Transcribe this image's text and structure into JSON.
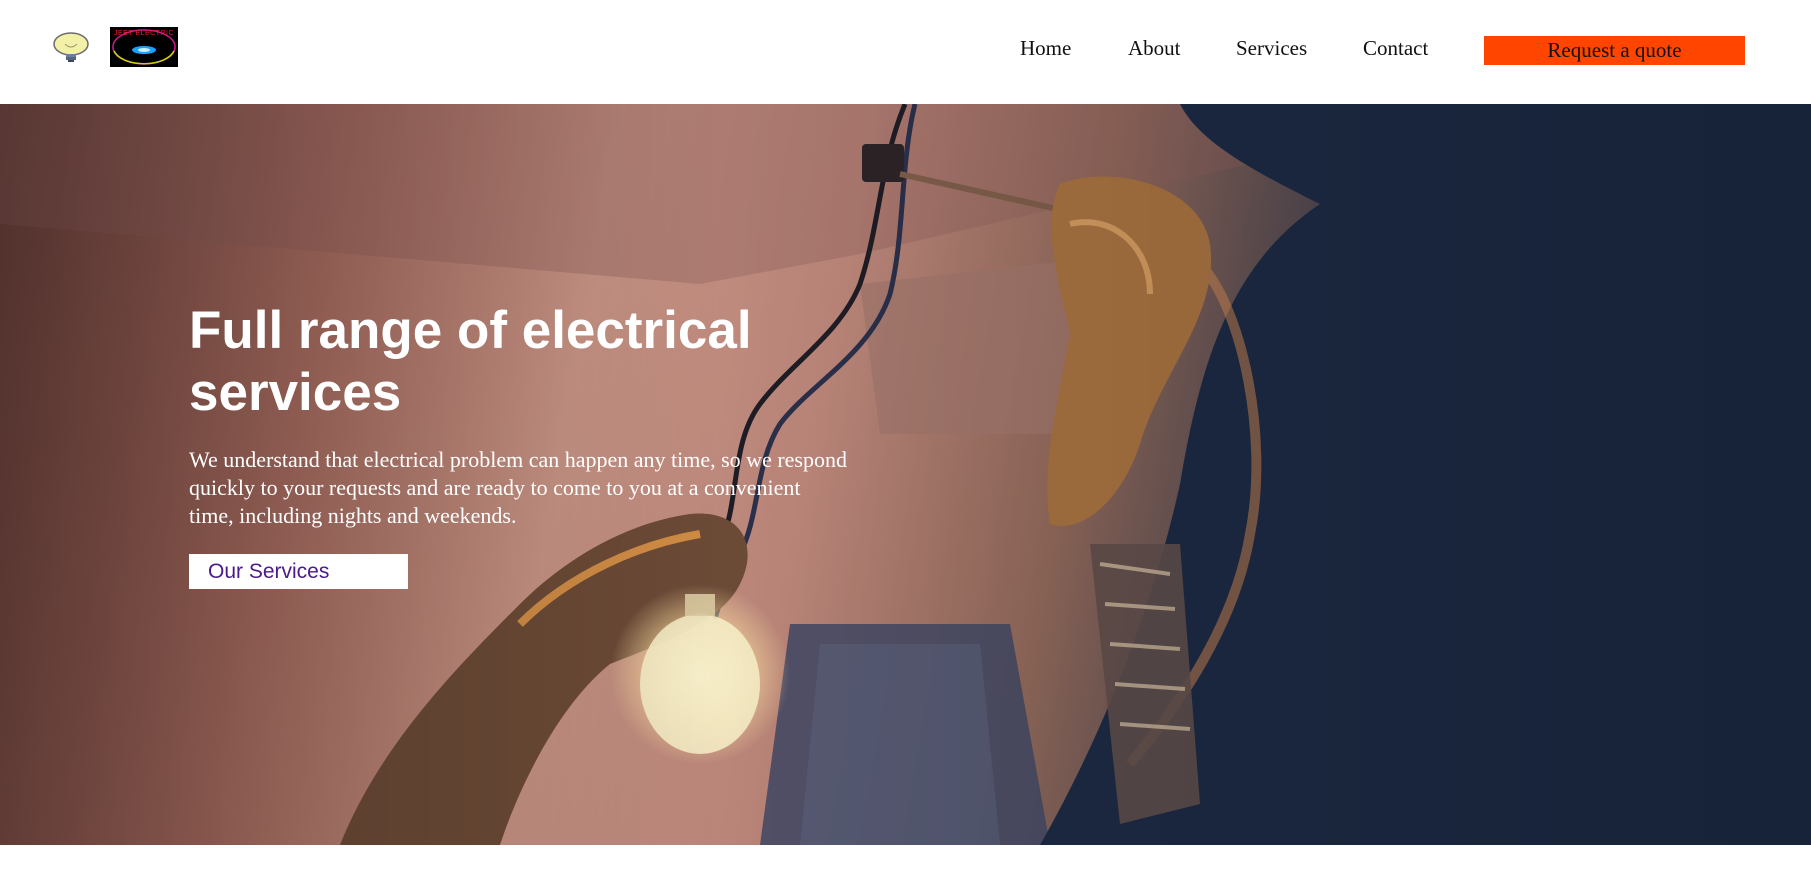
{
  "header": {
    "brand_text": "JEET ELECTRIC",
    "nav": [
      {
        "label": "Home"
      },
      {
        "label": "About"
      },
      {
        "label": "Services"
      },
      {
        "label": "Contact"
      }
    ],
    "quote_label": "Request a quote"
  },
  "hero": {
    "title": "Full range of electrical services",
    "description": "We understand that electrical problem can happen any time, so we respond quickly to your requests and are ready to come to you at a convenient time, including nights and weekends.",
    "cta_label": "Our Services"
  },
  "colors": {
    "accent": "#ff4500",
    "cta_text": "#4b1a8a",
    "hero_text": "#ffffff"
  },
  "icons": [
    "lightbulb-icon",
    "brand-logo"
  ]
}
